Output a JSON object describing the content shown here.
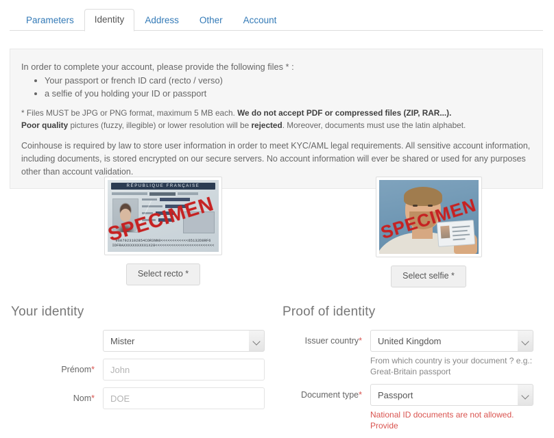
{
  "tabs": [
    {
      "label": "Parameters",
      "active": false
    },
    {
      "label": "Identity",
      "active": true
    },
    {
      "label": "Address",
      "active": false
    },
    {
      "label": "Other",
      "active": false
    },
    {
      "label": "Account",
      "active": false
    }
  ],
  "info": {
    "lead": "In order to complete your account, please provide the following files * :",
    "bullets": [
      "Your passport or french ID card (recto / verso)",
      "a selfie of you holding your ID or passport"
    ],
    "note_line1_plain1": "* Files MUST be JPG or PNG format, maximum 5 MB each. ",
    "note_line1_bold": "We do not accept PDF or compressed files (ZIP, RAR...).",
    "note_line2_bold1": "Poor quality",
    "note_line2_plain1": " pictures (fuzzy, illegible) or lower resolution will be ",
    "note_line2_bold2": "rejected",
    "note_line2_plain2": ". Moreover, documents must use the latin alphabet.",
    "paragraph": "Coinhouse is required by law to store user information in order to meet KYC/AML legal requirements. All sensitive account information, including documents, is stored encrypted on our secure servers. No account information will ever be shared or used for any purposes other than account validation."
  },
  "documents": {
    "recto": {
      "button_label": "Select recto *",
      "watermark": "SPECIMEN",
      "card_header": "RÉPUBLIQUE FRANÇAISE",
      "mrz_line1": "IDFRAXXXXXXXXXX1X28<<<<<<<<<<<<<<<<<<<<<<<<<<",
      "mrz_line2": "9607923102854COR3NN0<<<<<<<<<<<<65132D8RF6"
    },
    "selfie": {
      "button_label": "Select selfie *",
      "watermark": "SPECIMEN"
    }
  },
  "your_identity": {
    "title": "Your identity",
    "civility": {
      "label": "",
      "value": "Mister"
    },
    "firstname": {
      "label": "Prénom",
      "required": "*",
      "placeholder": "John",
      "value": ""
    },
    "lastname": {
      "label": "Nom",
      "required": "*",
      "placeholder": "DOE",
      "value": ""
    }
  },
  "proof_of_identity": {
    "title": "Proof of identity",
    "issuer_country": {
      "label": "Issuer country",
      "required": "*",
      "value": "United Kingdom",
      "help": "From which country is your document ? e.g.: Great-Britain passport"
    },
    "document_type": {
      "label": "Document type",
      "required": "*",
      "value": "Passport",
      "help": "National ID documents are not allowed. Provide"
    }
  },
  "colors": {
    "link": "#337ab7",
    "required": "#d9534f",
    "panel_bg": "#f6f6f6",
    "specimen": "#c62222"
  }
}
